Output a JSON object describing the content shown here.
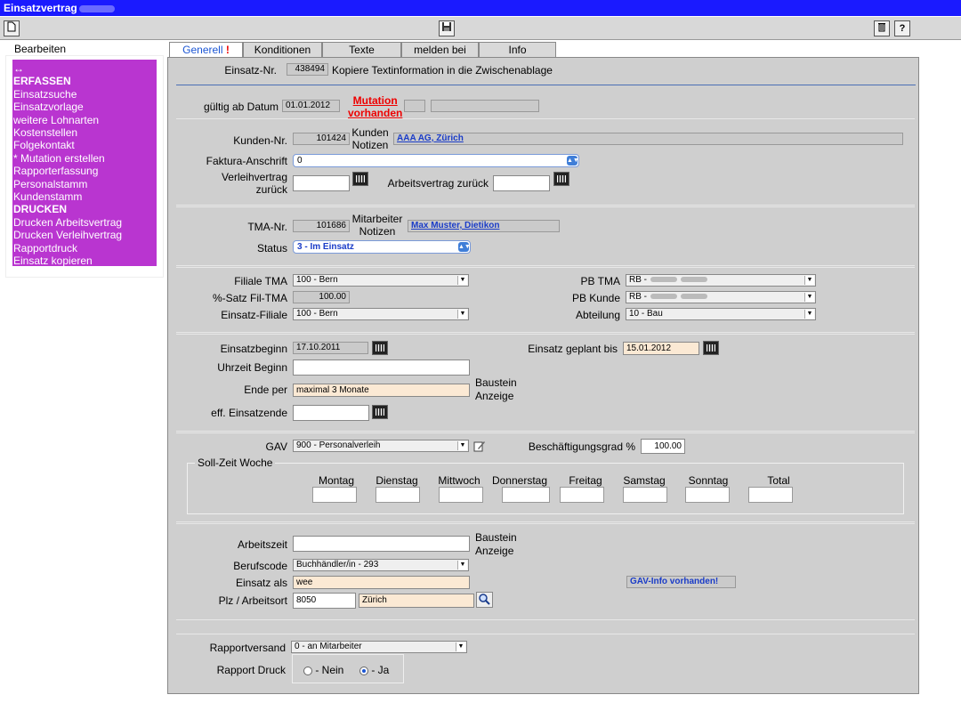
{
  "window": {
    "title": "Einsatzvertrag"
  },
  "toolbar": {
    "new_icon": "document-icon",
    "save_icon": "floppy-icon",
    "delete_icon": "trash-icon",
    "help_label": "?"
  },
  "sidebar": {
    "heading": "Bearbeiten",
    "items": [
      "↔",
      "ERFASSEN",
      "Einsatzsuche",
      "Einsatzvorlage",
      "weitere Lohnarten",
      "Kostenstellen",
      "Folgekontakt",
      "* Mutation erstellen",
      "Rapporterfassung",
      "Personalstamm",
      "Kundenstamm",
      "DRUCKEN",
      "Drucken Arbeitsvertrag",
      "Drucken Verleihvertrag",
      "Rapportdruck",
      "Einsatz kopieren"
    ],
    "bg_color": "#b935d0"
  },
  "tabs": [
    {
      "label": "Generell",
      "alert": "!"
    },
    {
      "label": "Konditionen"
    },
    {
      "label": "Texte"
    },
    {
      "label": "melden bei"
    },
    {
      "label": "Info"
    }
  ],
  "header": {
    "einsatz_nr_label": "Einsatz-Nr.",
    "einsatz_nr": "438494",
    "copy_text": "Kopiere Textinformation in die Zwischenablage"
  },
  "gueltig": {
    "label": "gültig ab Datum",
    "value": "01.01.2012",
    "mutation_line1": "Mutation",
    "mutation_line2": "vorhanden"
  },
  "kunde": {
    "nr_label": "Kunden-Nr.",
    "nr": "101424",
    "notizen_label1": "Kunden",
    "notizen_label2": "Notizen",
    "name": "AAA AG, Zürich",
    "faktura_label": "Faktura-Anschrift",
    "faktura_value": "0",
    "verleih_label1": "Verleihvertrag",
    "verleih_label2": "zurück",
    "arbeitsvertrag_label": "Arbeitsvertrag zurück"
  },
  "tma": {
    "nr_label": "TMA-Nr.",
    "nr": "101686",
    "notizen_label1": "Mitarbeiter",
    "notizen_label2": "Notizen",
    "name": "Max Muster, Dietikon",
    "status_label": "Status",
    "status_value": "3 - Im Einsatz"
  },
  "filiale": {
    "filiale_tma_label": "Filiale TMA",
    "filiale_tma": "100 - Bern",
    "satz_label": "%-Satz Fil-TMA",
    "satz": "100.00",
    "einsatz_filiale_label": "Einsatz-Filiale",
    "einsatz_filiale": "100 - Bern",
    "pb_tma_label": "PB TMA",
    "pb_tma": "RB -",
    "pb_kunde_label": "PB Kunde",
    "pb_kunde": "RB -",
    "abteilung_label": "Abteilung",
    "abteilung": "10 - Bau"
  },
  "einsatz": {
    "beginn_label": "Einsatzbeginn",
    "beginn": "17.10.2011",
    "geplant_label": "Einsatz geplant bis",
    "geplant": "15.01.2012",
    "uhrzeit_label": "Uhrzeit Beginn",
    "ende_label": "Ende per",
    "ende": "maximal 3 Monate",
    "baustein_label1": "Baustein",
    "baustein_label2": "Anzeige",
    "eff_label": "eff. Einsatzende"
  },
  "gav": {
    "label": "GAV",
    "value": "900 - Personalverleih",
    "grad_label": "Beschäftigungsgrad %",
    "grad": "100.00",
    "sollzeit_label": "Soll-Zeit Woche",
    "days": [
      "Montag",
      "Dienstag",
      "Mittwoch",
      "Donnerstag",
      "Freitag",
      "Samstag",
      "Sonntag",
      "Total"
    ]
  },
  "arbeit": {
    "zeit_label": "Arbeitszeit",
    "baustein_label1": "Baustein",
    "baustein_label2": "Anzeige",
    "berufscode_label": "Berufscode",
    "berufscode": "Buchhändler/in - 293",
    "als_label": "Einsatz als",
    "als": "wee",
    "gav_info": "GAV-Info vorhanden!",
    "plz_label": "Plz / Arbeitsort",
    "plz": "8050",
    "ort": "Zürich"
  },
  "rapport": {
    "versand_label": "Rapportversand",
    "versand": "0 - an Mitarbeiter",
    "druck_label": "Rapport Druck",
    "nein_label": "- Nein",
    "ja_label": "- Ja",
    "selected": "ja"
  }
}
